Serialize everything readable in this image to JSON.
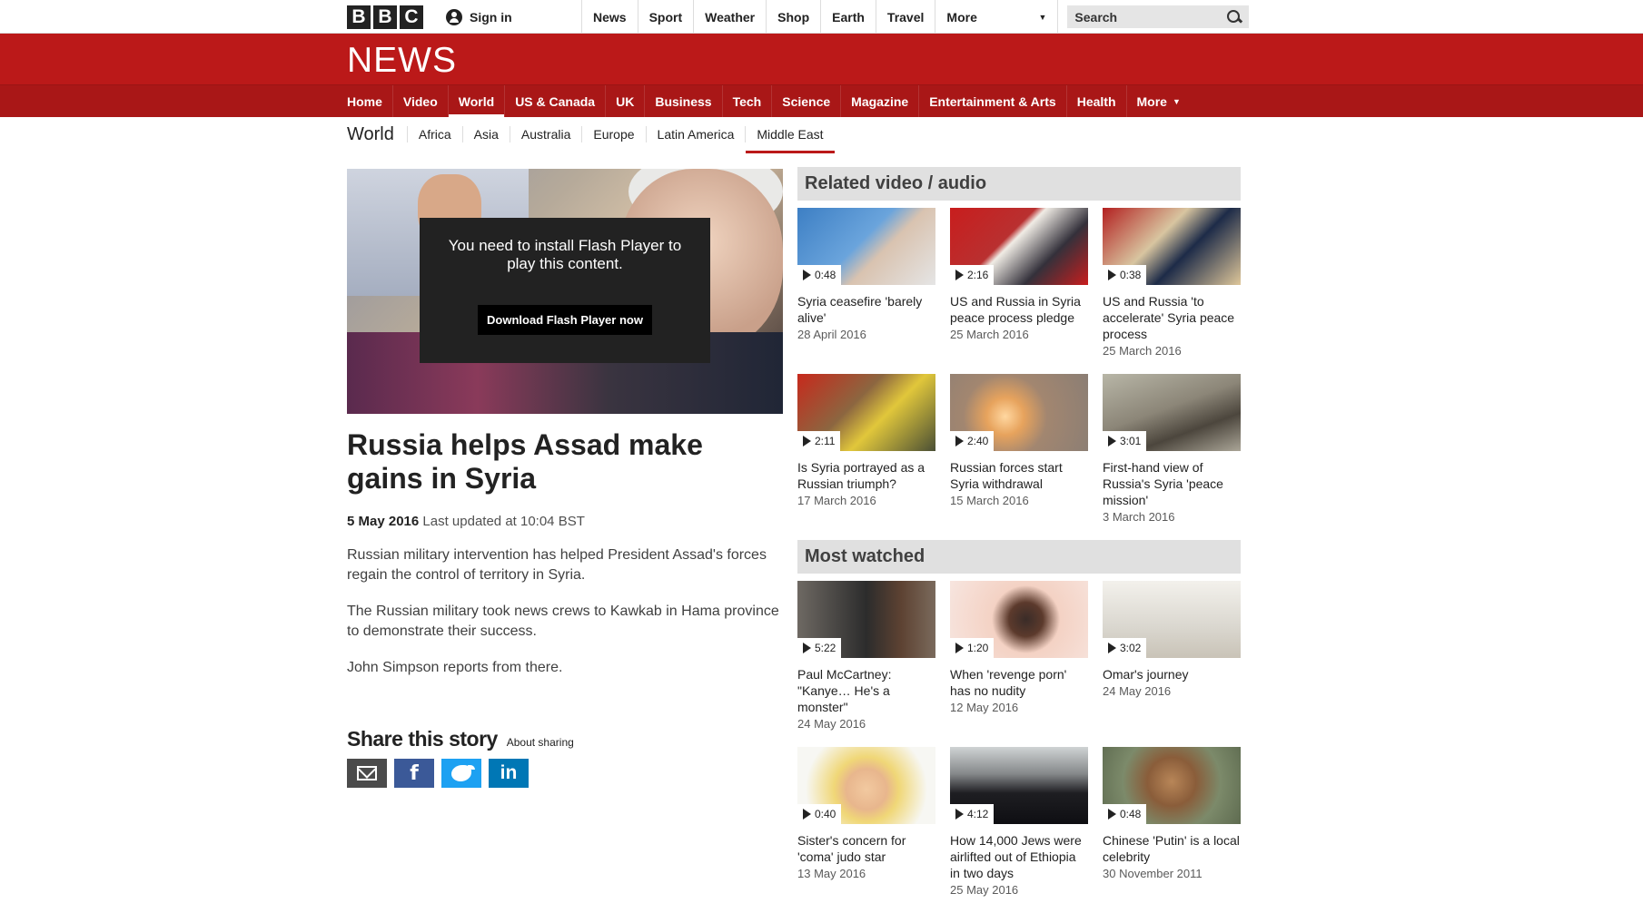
{
  "topbar": {
    "logo_letters": [
      "B",
      "B",
      "C"
    ],
    "signin_label": "Sign in",
    "nav": [
      "News",
      "Sport",
      "Weather",
      "Shop",
      "Earth",
      "Travel"
    ],
    "more_label": "More",
    "search_placeholder": "Search"
  },
  "masthead": {
    "title": "NEWS",
    "nav": [
      {
        "label": "Home",
        "active": false
      },
      {
        "label": "Video",
        "active": false
      },
      {
        "label": "World",
        "active": true
      },
      {
        "label": "US & Canada",
        "active": false
      },
      {
        "label": "UK",
        "active": false
      },
      {
        "label": "Business",
        "active": false
      },
      {
        "label": "Tech",
        "active": false
      },
      {
        "label": "Science",
        "active": false
      },
      {
        "label": "Magazine",
        "active": false
      },
      {
        "label": "Entertainment & Arts",
        "active": false
      },
      {
        "label": "Health",
        "active": false
      }
    ],
    "more_label": "More"
  },
  "subnav": {
    "section": "World",
    "items": [
      {
        "label": "Africa",
        "active": false
      },
      {
        "label": "Asia",
        "active": false
      },
      {
        "label": "Australia",
        "active": false
      },
      {
        "label": "Europe",
        "active": false
      },
      {
        "label": "Latin America",
        "active": false
      },
      {
        "label": "Middle East",
        "active": true
      }
    ]
  },
  "article": {
    "flash_message": "You need to install Flash Player to play this content.",
    "flash_button": "Download Flash Player now",
    "headline": "Russia helps Assad make gains in Syria",
    "date": "5 May 2016",
    "updated": "Last updated at 10:04 BST",
    "paragraphs": [
      "Russian military intervention has helped President Assad's forces regain the control of territory in Syria.",
      "The Russian military took news crews to Kawkab in Hama province to demonstrate their success.",
      "John Simpson reports from there."
    ],
    "share_title": "Share this story",
    "share_about": "About sharing"
  },
  "related": {
    "heading": "Related video / audio",
    "items": [
      {
        "duration": "0:48",
        "title": "Syria ceasefire 'barely alive'",
        "date": "28 April 2016"
      },
      {
        "duration": "2:16",
        "title": "US and Russia in Syria peace process pledge",
        "date": "25 March 2016"
      },
      {
        "duration": "0:38",
        "title": "US and Russia 'to accelerate' Syria peace process",
        "date": "25 March 2016"
      },
      {
        "duration": "2:11",
        "title": "Is Syria portrayed as a Russian triumph?",
        "date": "17 March 2016"
      },
      {
        "duration": "2:40",
        "title": "Russian forces start Syria withdrawal",
        "date": "15 March 2016"
      },
      {
        "duration": "3:01",
        "title": "First-hand view of Russia's Syria 'peace mission'",
        "date": "3 March 2016"
      }
    ]
  },
  "most_watched": {
    "heading": "Most watched",
    "items": [
      {
        "duration": "5:22",
        "title": "Paul McCartney: \"Kanye… He's a monster\"",
        "date": "24 May 2016"
      },
      {
        "duration": "1:20",
        "title": "When 'revenge porn' has no nudity",
        "date": "12 May 2016"
      },
      {
        "duration": "3:02",
        "title": "Omar's journey",
        "date": "24 May 2016"
      },
      {
        "duration": "0:40",
        "title": "Sister's concern for 'coma' judo star",
        "date": "13 May 2016"
      },
      {
        "duration": "4:12",
        "title": "How 14,000 Jews were airlifted out of Ethiopia in two days",
        "date": "25 May 2016"
      },
      {
        "duration": "0:48",
        "title": "Chinese 'Putin' is a local celebrity",
        "date": "30 November 2011"
      }
    ]
  }
}
